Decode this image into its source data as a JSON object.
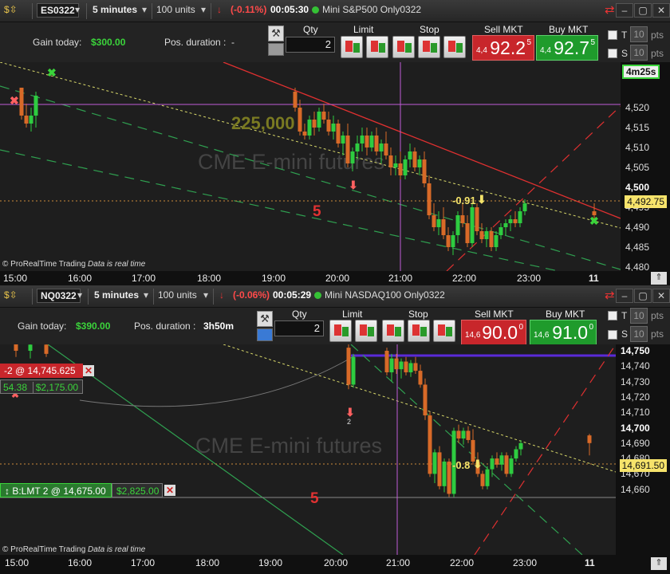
{
  "colors": {
    "sell": "#c8262b",
    "buy": "#1f9b2c",
    "gain": "#3bd43b",
    "negative_change": "#ff4a4a",
    "tag": "#f6e36b",
    "purple": "#c05cd8"
  },
  "icons": [
    "dollar-icon",
    "chevron-down-icon",
    "status-dot-icon",
    "refresh-icon",
    "minimize-icon",
    "maximize-icon",
    "close-icon",
    "wrench-icon",
    "keyboard-icon",
    "buy-limit-icon",
    "sell-limit-icon",
    "buy-stop-icon",
    "sell-stop-icon",
    "down-arrow-icon",
    "cross-marker-icon",
    "scroll-up-icon"
  ],
  "charts": [
    {
      "header": {
        "symbol": "ES0322",
        "timeframe": "5 minutes",
        "units": "100 units",
        "change": "(-0.11%)",
        "clock": "00:05:30",
        "name": "Mini S&P500 Only0322"
      },
      "toolbar": {
        "gain_label": "Gain today:",
        "gain_value": "$300.00",
        "pos_label": "Pos. duration :",
        "pos_value": "-",
        "qty_label": "Qty",
        "qty_value": "2",
        "limit_label": "Limit",
        "stop_label": "Stop",
        "sell_label": "Sell MKT",
        "sell_small": "4,4",
        "sell_big": "92.2",
        "sell_sup": "5",
        "buy_label": "Buy MKT",
        "buy_small": "4,4",
        "buy_big": "92.7",
        "buy_sup": "5",
        "t_label": "T",
        "t_value": "10",
        "s_label": "S",
        "s_value": "10",
        "pts": "pts"
      },
      "price_axis": [
        "4,520",
        "4,515",
        "4,510",
        "4,505",
        "4,500",
        "4,495",
        "4,490",
        "4,485",
        "4,480"
      ],
      "bold_ticks": [
        "4,500"
      ],
      "time_axis": [
        "15:00",
        "16:00",
        "17:00",
        "18:00",
        "19:00",
        "20:00",
        "21:00",
        "22:00",
        "23:00",
        "11"
      ],
      "timer": "4m25s",
      "last_price": "4,492.75",
      "watermark": "CME E-mini futures",
      "volume_label": "225,000",
      "count_label": "5",
      "annotation": "-0.91",
      "footer_brand": "© ProRealTime Trading",
      "footer_status": "Data is real time",
      "candles": [
        [
          27,
          4525,
          4525,
          4517,
          4518
        ],
        [
          33,
          4518,
          4521,
          4515,
          4516
        ],
        [
          39,
          4516,
          4520,
          4514,
          4518
        ],
        [
          45,
          4518,
          4524,
          4515,
          4523
        ],
        [
          370,
          4524,
          4525,
          4519,
          4520
        ],
        [
          376,
          4520,
          4522,
          4513,
          4514
        ],
        [
          382,
          4514,
          4516,
          4512,
          4513
        ],
        [
          388,
          4513,
          4518,
          4512,
          4517
        ],
        [
          394,
          4517,
          4519,
          4513,
          4515
        ],
        [
          400,
          4515,
          4520,
          4514,
          4519
        ],
        [
          406,
          4519,
          4521,
          4516,
          4517
        ],
        [
          412,
          4517,
          4519,
          4513,
          4514
        ],
        [
          418,
          4514,
          4518,
          4512,
          4516
        ],
        [
          424,
          4516,
          4517,
          4510,
          4511
        ],
        [
          430,
          4511,
          4514,
          4508,
          4513
        ],
        [
          436,
          4513,
          4516,
          4505,
          4506
        ],
        [
          442,
          4506,
          4510,
          4504,
          4509
        ],
        [
          448,
          4509,
          4513,
          4507,
          4511
        ],
        [
          454,
          4511,
          4515,
          4509,
          4513
        ],
        [
          460,
          4513,
          4515,
          4508,
          4510
        ],
        [
          466,
          4510,
          4514,
          4509,
          4513
        ],
        [
          472,
          4513,
          4515,
          4508,
          4509
        ],
        [
          478,
          4509,
          4512,
          4506,
          4511
        ],
        [
          484,
          4511,
          4514,
          4507,
          4508
        ],
        [
          490,
          4508,
          4510,
          4503,
          4505
        ],
        [
          496,
          4505,
          4508,
          4503,
          4506
        ],
        [
          502,
          4506,
          4509,
          4502,
          4503
        ],
        [
          508,
          4503,
          4508,
          4502,
          4507
        ],
        [
          514,
          4507,
          4511,
          4505,
          4509
        ],
        [
          520,
          4509,
          4510,
          4504,
          4505
        ],
        [
          526,
          4505,
          4508,
          4503,
          4507
        ],
        [
          532,
          4507,
          4509,
          4500,
          4501
        ],
        [
          538,
          4501,
          4503,
          4492,
          4493
        ],
        [
          544,
          4493,
          4496,
          4489,
          4490
        ],
        [
          550,
          4490,
          4494,
          4488,
          4492
        ],
        [
          556,
          4492,
          4495,
          4487,
          4488
        ],
        [
          562,
          4488,
          4490,
          4484,
          4485
        ],
        [
          568,
          4485,
          4489,
          4483,
          4488
        ],
        [
          574,
          4488,
          4494,
          4486,
          4493
        ],
        [
          580,
          4493,
          4496,
          4490,
          4491
        ],
        [
          586,
          4491,
          4493,
          4485,
          4486
        ],
        [
          592,
          4486,
          4496,
          4485,
          4495
        ],
        [
          598,
          4495,
          4496,
          4488,
          4489
        ],
        [
          604,
          4489,
          4491,
          4486,
          4487
        ],
        [
          610,
          4487,
          4490,
          4485,
          4489
        ],
        [
          616,
          4489,
          4490,
          4484,
          4485
        ],
        [
          622,
          4485,
          4489,
          4484,
          4488
        ],
        [
          628,
          4488,
          4491,
          4487,
          4490
        ],
        [
          634,
          4490,
          4492,
          4488,
          4491
        ],
        [
          640,
          4491,
          4493,
          4489,
          4492
        ],
        [
          646,
          4492,
          4494,
          4490,
          4491
        ],
        [
          652,
          4491,
          4495,
          4490,
          4494
        ],
        [
          658,
          4494,
          4497,
          4493,
          4496
        ],
        [
          745,
          4494,
          4496,
          4492,
          4493
        ]
      ]
    },
    {
      "header": {
        "symbol": "NQ0322",
        "timeframe": "5 minutes",
        "units": "100 units",
        "change": "(-0.06%)",
        "clock": "00:05:29",
        "name": "Mini NASDAQ100 Only0322"
      },
      "toolbar": {
        "gain_label": "Gain today:",
        "gain_value": "$390.00",
        "pos_label": "Pos. duration :",
        "pos_value": "3h50m",
        "qty_label": "Qty",
        "qty_value": "2",
        "limit_label": "Limit",
        "stop_label": "Stop",
        "sell_label": "Sell MKT",
        "sell_small": "14,6",
        "sell_big": "90.0",
        "sell_sup": "0",
        "buy_label": "Buy MKT",
        "buy_small": "14,6",
        "buy_big": "91.0",
        "buy_sup": "0",
        "t_label": "T",
        "t_value": "10",
        "s_label": "S",
        "s_value": "10",
        "pts": "pts"
      },
      "price_axis": [
        "14,750",
        "14,740",
        "14,730",
        "14,720",
        "14,710",
        "14,700",
        "14,690",
        "14,680",
        "14,670",
        "14,660"
      ],
      "bold_ticks": [
        "14,750",
        "14,700"
      ],
      "time_axis": [
        "15:00",
        "16:00",
        "17:00",
        "18:00",
        "19:00",
        "20:00",
        "21:00",
        "22:00",
        "23:00",
        "11"
      ],
      "last_price": "14,691.50",
      "watermark": "CME E-mini futures",
      "count_label": "5",
      "annotation": "-0.8",
      "marker_count": "2",
      "position_order": {
        "label": "-2 @ 14,745.625",
        "pts": "54.38",
        "pnl": "$2,175.00"
      },
      "limit_order": {
        "label": "B:LMT  2 @ 14,675.00",
        "pnl": "$2,825.00"
      },
      "footer_brand": "© ProRealTime Trading",
      "footer_status": "Data is real time",
      "candles": [
        [
          20,
          14755,
          14758,
          14746,
          14750
        ],
        [
          38,
          14750,
          14756,
          14745,
          14754
        ],
        [
          58,
          14754,
          14758,
          14746,
          14748
        ],
        [
          437,
          14752,
          14755,
          14725,
          14728
        ],
        [
          443,
          14728,
          14748,
          14726,
          14746
        ],
        [
          485,
          14750,
          14752,
          14734,
          14736
        ],
        [
          491,
          14736,
          14748,
          14730,
          14745
        ],
        [
          497,
          14745,
          14748,
          14735,
          14738
        ],
        [
          503,
          14738,
          14745,
          14732,
          14743
        ],
        [
          509,
          14743,
          14746,
          14734,
          14736
        ],
        [
          515,
          14736,
          14744,
          14733,
          14742
        ],
        [
          521,
          14742,
          14746,
          14735,
          14737
        ],
        [
          527,
          14737,
          14741,
          14726,
          14728
        ],
        [
          533,
          14728,
          14732,
          14705,
          14708
        ],
        [
          539,
          14708,
          14710,
          14668,
          14670
        ],
        [
          545,
          14670,
          14686,
          14664,
          14684
        ],
        [
          551,
          14684,
          14688,
          14660,
          14662
        ],
        [
          557,
          14662,
          14680,
          14658,
          14678
        ],
        [
          563,
          14678,
          14680,
          14655,
          14657
        ],
        [
          569,
          14657,
          14700,
          14655,
          14698
        ],
        [
          575,
          14698,
          14702,
          14690,
          14693
        ],
        [
          581,
          14693,
          14700,
          14689,
          14698
        ],
        [
          587,
          14698,
          14701,
          14690,
          14692
        ],
        [
          593,
          14692,
          14699,
          14676,
          14678
        ],
        [
          599,
          14678,
          14684,
          14668,
          14670
        ],
        [
          605,
          14670,
          14672,
          14660,
          14662
        ],
        [
          611,
          14662,
          14675,
          14660,
          14673
        ],
        [
          617,
          14673,
          14682,
          14668,
          14680
        ],
        [
          623,
          14680,
          14684,
          14674,
          14676
        ],
        [
          629,
          14676,
          14684,
          14672,
          14682
        ],
        [
          635,
          14682,
          14684,
          14668,
          14670
        ],
        [
          641,
          14670,
          14682,
          14668,
          14680
        ],
        [
          647,
          14680,
          14688,
          14678,
          14686
        ],
        [
          653,
          14686,
          14692,
          14682,
          14690
        ],
        [
          739,
          14695,
          14696,
          14682,
          14690
        ]
      ]
    }
  ]
}
